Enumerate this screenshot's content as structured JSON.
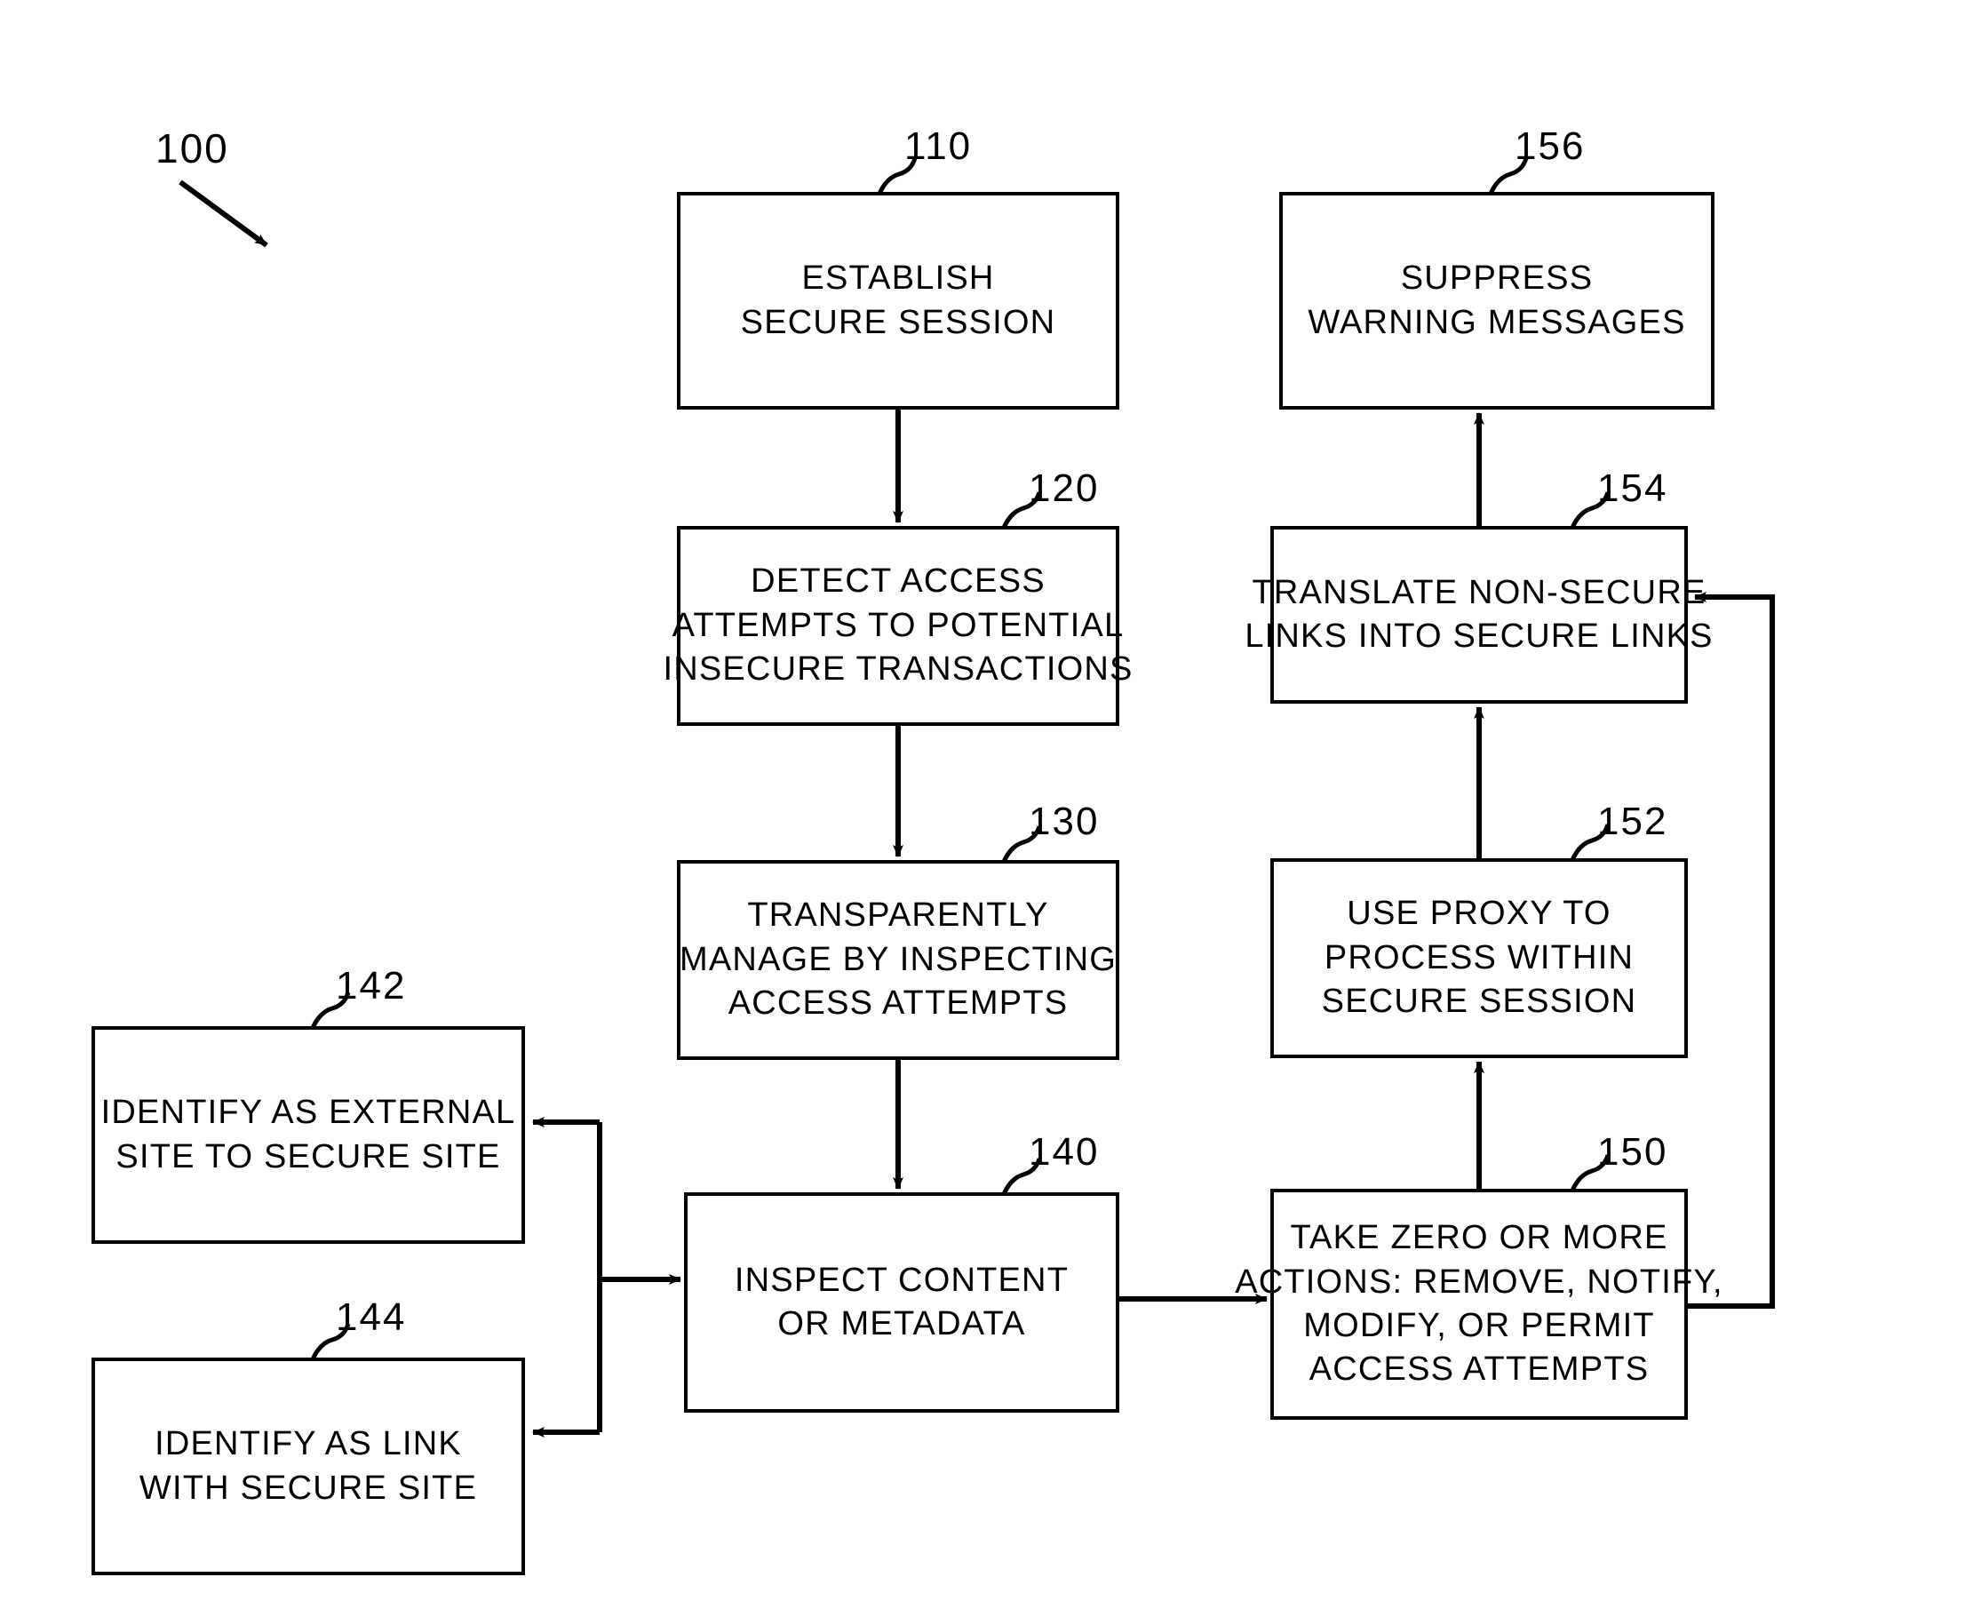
{
  "figure": {
    "number": "100"
  },
  "boxes": {
    "b110": {
      "ref": "110",
      "lines": [
        "ESTABLISH",
        "SECURE SESSION"
      ]
    },
    "b120": {
      "ref": "120",
      "lines": [
        "DETECT ACCESS",
        "ATTEMPTS TO POTENTIAL",
        "INSECURE TRANSACTIONS"
      ]
    },
    "b130": {
      "ref": "130",
      "lines": [
        "TRANSPARENTLY",
        "MANAGE BY INSPECTING",
        "ACCESS ATTEMPTS"
      ]
    },
    "b140": {
      "ref": "140",
      "lines": [
        "INSPECT CONTENT",
        "OR METADATA"
      ]
    },
    "b142": {
      "ref": "142",
      "lines": [
        "IDENTIFY AS EXTERNAL",
        "SITE TO SECURE SITE"
      ]
    },
    "b144": {
      "ref": "144",
      "lines": [
        "IDENTIFY AS LINK",
        "WITH SECURE SITE"
      ]
    },
    "b150": {
      "ref": "150",
      "lines": [
        "TAKE ZERO OR MORE",
        "ACTIONS: REMOVE, NOTIFY,",
        "MODIFY, OR PERMIT",
        "ACCESS ATTEMPTS"
      ]
    },
    "b152": {
      "ref": "152",
      "lines": [
        "USE PROXY TO",
        "PROCESS WITHIN",
        "SECURE SESSION"
      ]
    },
    "b154": {
      "ref": "154",
      "lines": [
        "TRANSLATE NON-SECURE",
        "LINKS INTO SECURE LINKS"
      ]
    },
    "b156": {
      "ref": "156",
      "lines": [
        "SUPPRESS",
        "WARNING MESSAGES"
      ]
    }
  },
  "colors": {
    "ink": "#000000",
    "paper": "#ffffff"
  }
}
